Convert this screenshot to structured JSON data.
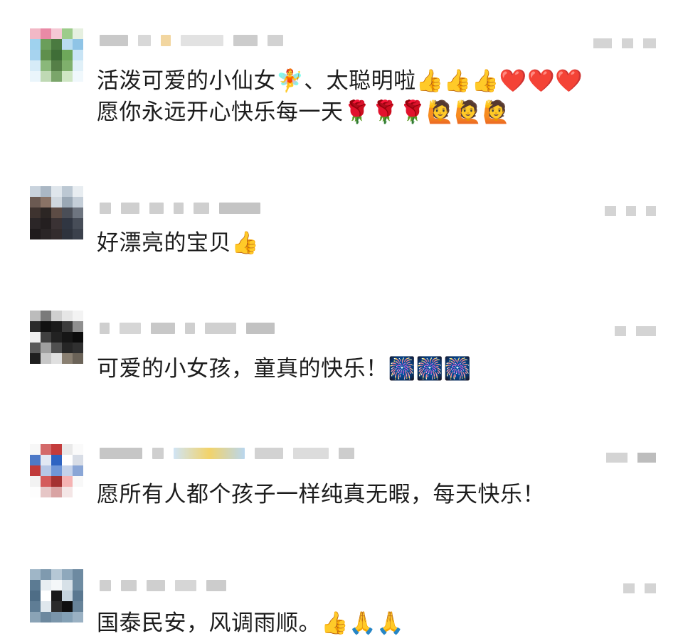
{
  "comments": [
    {
      "text": "活泼可爱的小仙女🧚、太聪明啦👍👍👍❤️❤️❤️\n愿你永远开心快乐每一天🌹🌹🌹🙋🙋🙋",
      "avatar_colors": [
        "#f2b8c6",
        "#e98aa6",
        "#f5c8d4",
        "#9ccc8a",
        "#e6f0e0",
        "#9fd2ee",
        "#6a9e5a",
        "#4a7a40",
        "#b9dcf0",
        "#8fc4e6",
        "#a6d3ef",
        "#5f8f4c",
        "#3f6e37",
        "#6ea85a",
        "#c8e4f5",
        "#d6ebf7",
        "#8ab87a",
        "#557f47",
        "#7fb06c",
        "#e0f0f8",
        "#eaf5fb",
        "#bfd9b4",
        "#7aa56a",
        "#cfe6c4",
        "#f0f8fc"
      ]
    },
    {
      "text": "好漂亮的宝贝👍",
      "avatar_colors": [
        "#c9d3dd",
        "#aab7c4",
        "#dfe6ec",
        "#bcc8d3",
        "#e8edf1",
        "#6b5a52",
        "#8a7366",
        "#cfd7de",
        "#9aa8b5",
        "#c4ced8",
        "#3e332f",
        "#2c2624",
        "#5d4c45",
        "#4a4e57",
        "#6e7580",
        "#2b2627",
        "#241f20",
        "#3a3234",
        "#303642",
        "#474d58",
        "#1f1b1c",
        "#2a2526",
        "#332c2d",
        "#2e333d",
        "#3b414c"
      ]
    },
    {
      "text": "可爱的小女孩，童真的快乐！🎆🎆🎆",
      "avatar_colors": [
        "#bcbcbc",
        "#7a7a7a",
        "#cfcfcf",
        "#e6e6e6",
        "#f3f3f3",
        "#2a2a2a",
        "#111111",
        "#1a1a1a",
        "#3c3c3c",
        "#8f8f8f",
        "#f0f0f0",
        "#404040",
        "#222222",
        "#161616",
        "#0c0c0c",
        "#5a5a5a",
        "#a0a0a0",
        "#505050",
        "#262626",
        "#303030",
        "#1e1e1e",
        "#c7c7c7",
        "#e0e0e0",
        "#8a8072",
        "#6b6358"
      ]
    },
    {
      "text": "愿所有人都个孩子一样纯真无暇，每天快乐！",
      "avatar_colors": [
        "#f7f7f7",
        "#d46a6a",
        "#c43c3c",
        "#e9e9e9",
        "#fafafa",
        "#4d79c7",
        "#e2e8f3",
        "#2e63c2",
        "#ffffff",
        "#d8dde6",
        "#c03a3a",
        "#b6c7e6",
        "#6f96d8",
        "#c4d2ea",
        "#8aa6d6",
        "#f2f2f2",
        "#d45a5a",
        "#a43232",
        "#f5b3b3",
        "#f8f8f8",
        "#fdfdfd",
        "#e6c6c6",
        "#d9a3a3",
        "#f4e6e6",
        "#ffffff"
      ]
    },
    {
      "text": "国泰民安，风调雨顺。👍🙏🙏",
      "avatar_colors": [
        "#9fb6c7",
        "#7f9aaf",
        "#b5c7d5",
        "#8ea8bc",
        "#6d8aa1",
        "#5c7b93",
        "#e8eef2",
        "#f4f7f9",
        "#d7e1e8",
        "#6f8ca2",
        "#4e6d86",
        "#ffffff",
        "#1a1a1a",
        "#c6d4de",
        "#5a7890",
        "#5f7d95",
        "#dfe7ed",
        "#2b2b2b",
        "#0f0f0f",
        "#678399",
        "#8aa3b6",
        "#6c889e",
        "#7a95aa",
        "#83a0b5",
        "#9ab1c3"
      ]
    }
  ]
}
